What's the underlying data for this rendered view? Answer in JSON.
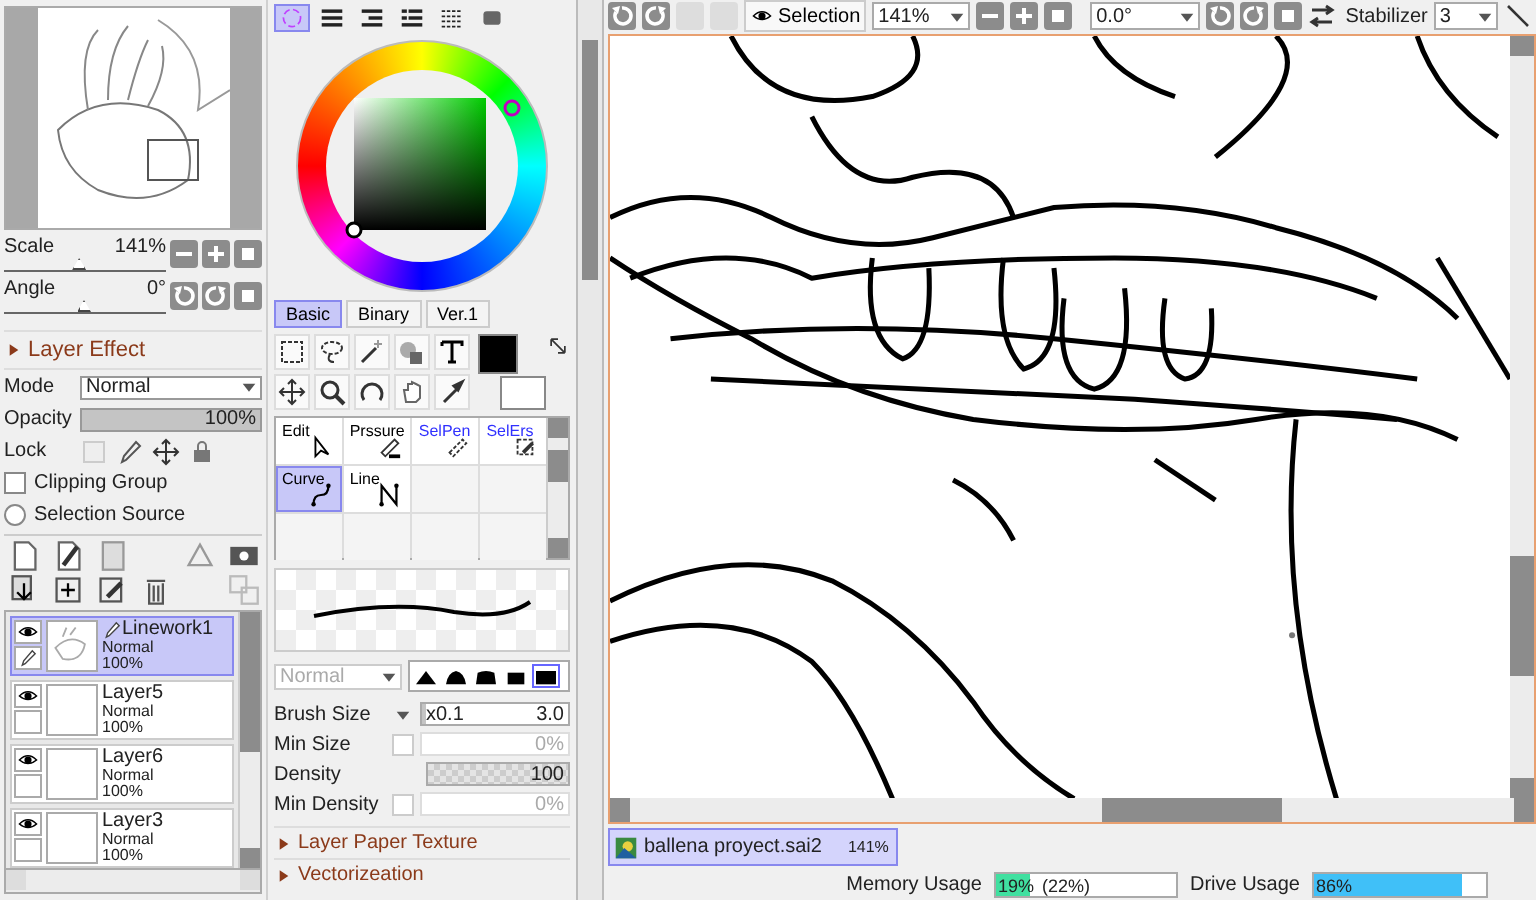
{
  "navigator": {
    "scale": {
      "label": "Scale",
      "value": "141%",
      "level": 0.47
    },
    "angle": {
      "label": "Angle",
      "value": "0°",
      "level": 0.5
    }
  },
  "layer_effect": {
    "title": "Layer Effect",
    "expanded": false
  },
  "layer_properties": {
    "mode_label": "Mode",
    "mode": "Normal",
    "opacity_label": "Opacity",
    "opacity": {
      "value": "100%",
      "level": 1
    },
    "lock_label": "Lock",
    "clipping_group": {
      "label": "Clipping Group",
      "checked": false
    },
    "selection_source": {
      "label": "Selection Source",
      "selected": false
    }
  },
  "layers": [
    {
      "name": "Linework1",
      "mode": "Normal",
      "opacity": "100%",
      "visible": true,
      "selected": true
    },
    {
      "name": "Layer5",
      "mode": "Normal",
      "opacity": "100%",
      "visible": true,
      "selected": false
    },
    {
      "name": "Layer6",
      "mode": "Normal",
      "opacity": "100%",
      "visible": true,
      "selected": false
    },
    {
      "name": "Layer3",
      "mode": "Normal",
      "opacity": "100%",
      "visible": true,
      "selected": false
    }
  ],
  "color_tabs": [
    {
      "selected": true
    },
    {
      "selected": false
    },
    {
      "selected": false
    },
    {
      "selected": false
    },
    {
      "selected": false
    },
    {
      "selected": false
    }
  ],
  "color_modes": [
    {
      "label": "Basic",
      "selected": true
    },
    {
      "label": "Binary",
      "selected": false
    },
    {
      "label": "Ver.1",
      "selected": false
    }
  ],
  "brush_tools": [
    {
      "label": "Edit",
      "selected": false,
      "color": "#000000"
    },
    {
      "label": "Prssure",
      "selected": false,
      "color": "#000000"
    },
    {
      "label": "SelPen",
      "selected": false,
      "color": "#3030ff"
    },
    {
      "label": "SelErs",
      "selected": false,
      "color": "#3030ff"
    },
    {
      "label": "Curve",
      "selected": true,
      "color": "#000000"
    },
    {
      "label": "Line",
      "selected": false,
      "color": "#000000"
    }
  ],
  "brush": {
    "blend": "Normal",
    "blend_disabled": true,
    "tip_shapes": [
      {
        "selected": false
      },
      {
        "selected": false
      },
      {
        "selected": false
      },
      {
        "selected": false
      },
      {
        "selected": true
      }
    ]
  },
  "settings": [
    {
      "kind": "size",
      "label": "Brush Size",
      "multiplier": "x0.1",
      "value": "3.0",
      "level": 0.03
    },
    {
      "kind": "check",
      "label": "Min Size",
      "checked": false,
      "value": "0%",
      "level": 0
    },
    {
      "kind": "density",
      "label": "Density",
      "value": "100",
      "level": 1
    },
    {
      "kind": "check",
      "label": "Min Density",
      "checked": false,
      "value": "0%",
      "level": 0
    }
  ],
  "sections": [
    {
      "title": "Layer Paper Texture",
      "expanded": false
    },
    {
      "title": "Vectorizeation",
      "expanded": false
    }
  ],
  "toolbar": {
    "selection_label": "Selection",
    "zoom": "141%",
    "angle": "0.0°",
    "stabilizer_label": "Stabilizer",
    "stabilizer": "3"
  },
  "document_tabs": [
    {
      "title": "ballena proyect.sai2",
      "zoom": "141%",
      "selected": true
    }
  ],
  "status_bar": {
    "memory": {
      "label": "Memory Usage",
      "value": "19%",
      "peak": "(22%)",
      "level": 0.19
    },
    "drive": {
      "label": "Drive Usage",
      "value": "86%",
      "level": 0.86
    }
  }
}
